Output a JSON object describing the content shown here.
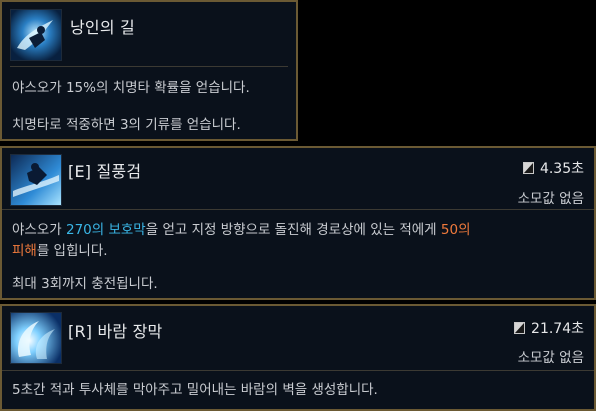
{
  "passive": {
    "title": "낭인의 길",
    "line1": "야스오가 15%의 치명타 확률을 얻습니다.",
    "line2": "치명타로 적중하면 3의 기류를 얻습니다."
  },
  "e_skill": {
    "title": "[E] 질풍검",
    "cooldown": "4.35초",
    "cost": "소모값 없음",
    "desc_pre": "야스오가 ",
    "desc_shield": "270의 보호막",
    "desc_mid": "을 얻고 지정 방향으로 돌진해 경로상에 있는 적에게 ",
    "desc_damage_1": "50의",
    "desc_damage_2": "피해",
    "desc_post": "를 입힙니다.",
    "charges": "최대 3회까지 충전됩니다."
  },
  "r_skill": {
    "title": "[R] 바람 장막",
    "cooldown": "21.74초",
    "cost": "소모값 없음",
    "desc": "5초간 적과 투사체를 막아주고 밀어내는 바람의 벽을 생성합니다."
  },
  "colors": {
    "border_gold": "#6b5a34",
    "panel_bg": "#0a111b",
    "shield_blue": "#3ab6e6",
    "damage_orange": "#f07a3c"
  },
  "icons": {
    "passive": "way-of-the-wanderer-icon",
    "e": "sweeping-blade-icon",
    "r": "wind-wall-icon",
    "cooldown": "hourglass-icon"
  }
}
